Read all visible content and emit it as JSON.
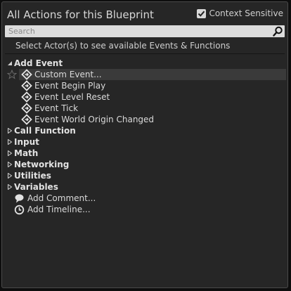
{
  "window": {
    "title": "All Actions for this Blueprint",
    "context_sensitive_label": "Context Sensitive",
    "context_sensitive_checked": true
  },
  "search": {
    "placeholder": "Search",
    "value": ""
  },
  "hint": "Select Actor(s) to see available Events & Functions",
  "tree": {
    "add_event": {
      "label": "Add Event",
      "expanded": true,
      "items": [
        {
          "label": "Custom Event...",
          "icon": "event-diamond-icon",
          "selected": true
        },
        {
          "label": "Event Begin Play",
          "icon": "event-diamond-icon"
        },
        {
          "label": "Event Level Reset",
          "icon": "event-diamond-icon"
        },
        {
          "label": "Event Tick",
          "icon": "event-diamond-icon"
        },
        {
          "label": "Event World Origin Changed",
          "icon": "event-diamond-icon"
        }
      ]
    },
    "categories": [
      {
        "label": "Call Function",
        "expanded": false
      },
      {
        "label": "Input",
        "expanded": false
      },
      {
        "label": "Math",
        "expanded": false
      },
      {
        "label": "Networking",
        "expanded": false
      },
      {
        "label": "Utilities",
        "expanded": false
      },
      {
        "label": "Variables",
        "expanded": false
      }
    ],
    "actions": [
      {
        "label": "Add Comment...",
        "icon": "comment-bubble-icon"
      },
      {
        "label": "Add Timeline...",
        "icon": "clock-icon"
      }
    ]
  },
  "colors": {
    "panel_bg": "#262626",
    "selected_row": "#3a3a3a",
    "search_bg": "#dcdcdc"
  }
}
